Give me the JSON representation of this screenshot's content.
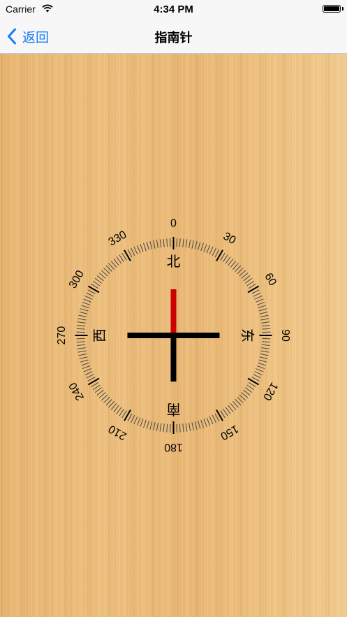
{
  "status_bar": {
    "carrier": "Carrier",
    "time": "4:34 PM"
  },
  "nav": {
    "back_label": "返回",
    "title": "指南针"
  },
  "compass": {
    "heading_degrees": 0,
    "degree_labels": [
      "0",
      "30",
      "60",
      "90",
      "120",
      "150",
      "180",
      "210",
      "240",
      "270",
      "300",
      "330"
    ],
    "cardinals": {
      "north": "北",
      "east": "东",
      "south": "南",
      "west": "西"
    }
  },
  "colors": {
    "accent": "#1a7cf5",
    "needle_north": "#cc0000",
    "needle_body": "#000000",
    "tick": "#444444"
  },
  "icons": {
    "back": "chevron-left-icon",
    "wifi": "wifi-icon",
    "battery": "battery-icon"
  }
}
